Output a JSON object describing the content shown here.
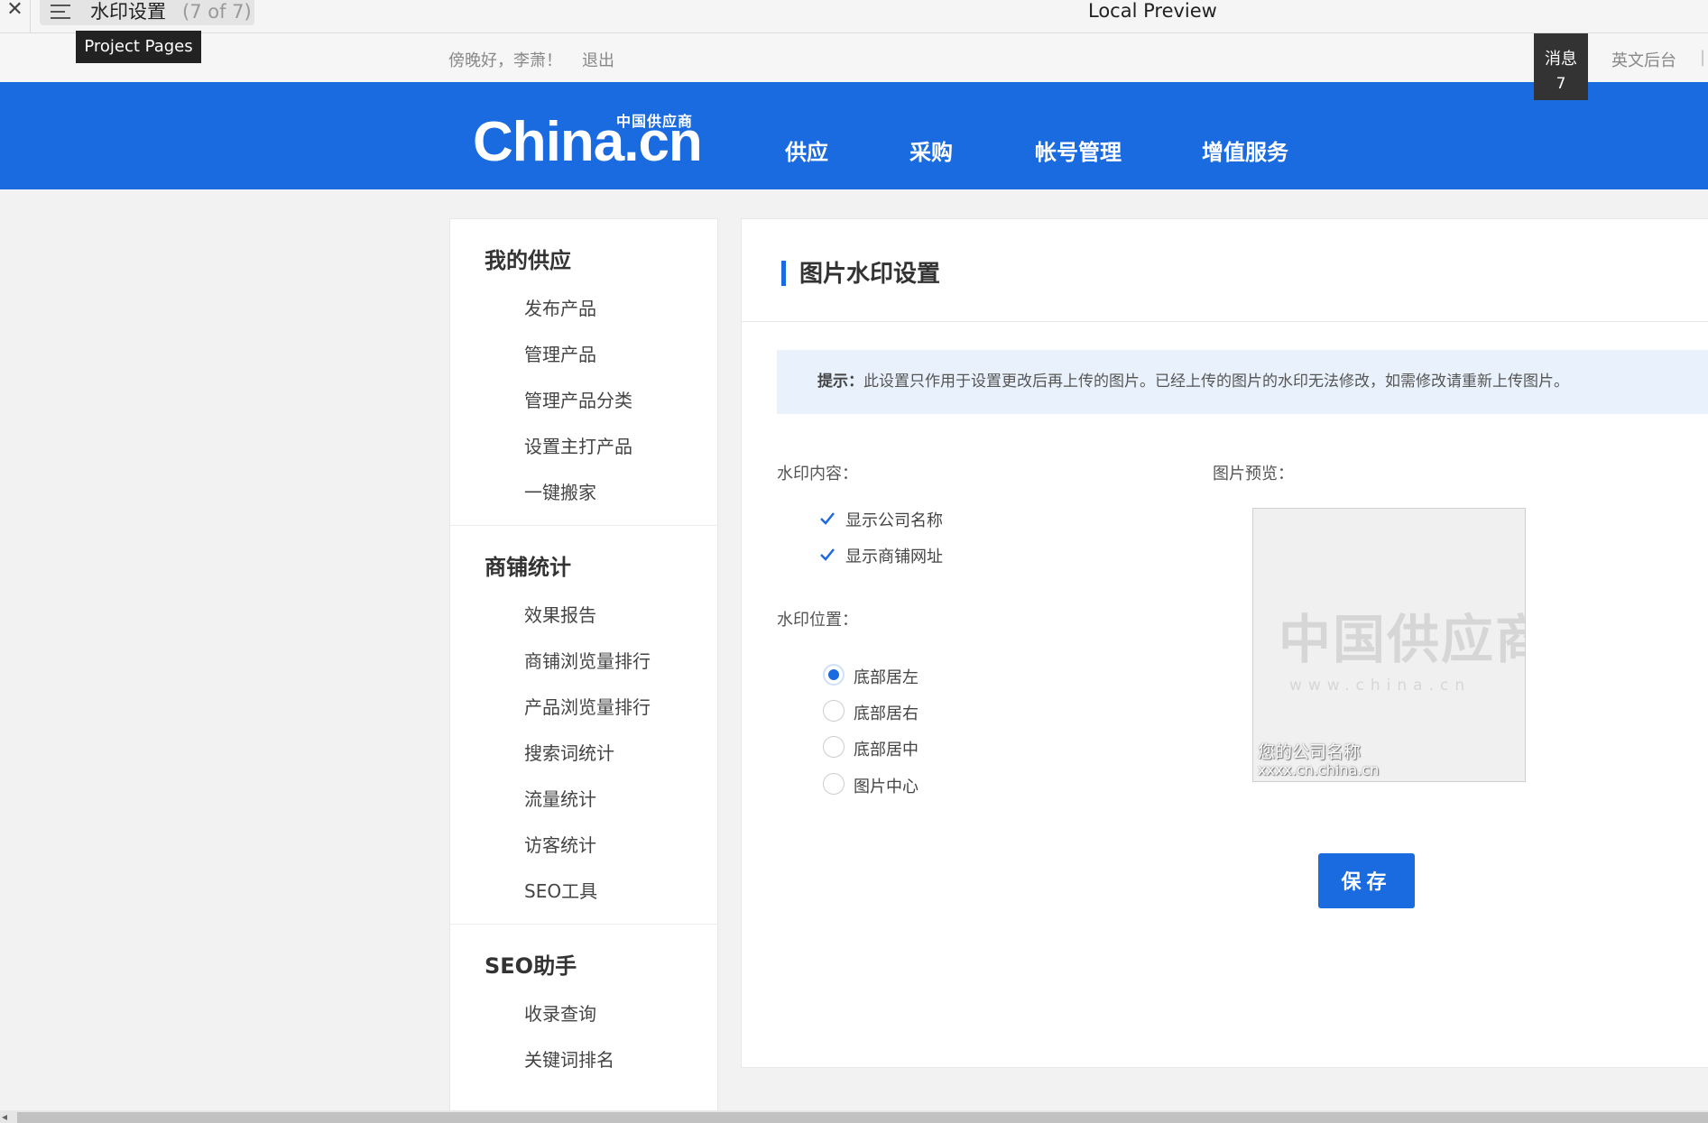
{
  "preview_bar": {
    "close_glyph": "✕",
    "doc_title": "水印设置",
    "doc_count": "(7 of 7)",
    "window_title": "Local Preview",
    "tooltip": "Project Pages"
  },
  "topbar": {
    "greeting": "傍晚好，李萧！",
    "logout": "退出",
    "message_label": "消息",
    "message_count": "7",
    "english_admin": "英文后台"
  },
  "header": {
    "logo_small": "中国供应商",
    "logo_main": "China.cn",
    "nav": [
      "供应",
      "采购",
      "帐号管理",
      "增值服务"
    ]
  },
  "sidebar": {
    "groups": [
      {
        "title": "我的供应",
        "items": [
          "发布产品",
          "管理产品",
          "管理产品分类",
          "设置主打产品",
          "一键搬家"
        ]
      },
      {
        "title": "商铺统计",
        "items": [
          "效果报告",
          "商铺浏览量排行",
          "产品浏览量排行",
          "搜索词统计",
          "流量统计",
          "访客统计",
          "SEO工具"
        ]
      },
      {
        "title": "SEO助手",
        "items": [
          "收录查询",
          "关键词排名"
        ]
      }
    ]
  },
  "main": {
    "title": "图片水印设置",
    "notice_prefix": "提示：",
    "notice_text": "此设置只作用于设置更改后再上传的图片。已经上传的图片的水印无法修改，如需修改请重新上传图片。",
    "content_label": "水印内容：",
    "content_options": [
      {
        "label": "显示公司名称",
        "checked": true
      },
      {
        "label": "显示商铺网址",
        "checked": true
      }
    ],
    "position_label": "水印位置：",
    "position_options": [
      {
        "label": "底部居左",
        "selected": true
      },
      {
        "label": "底部居右",
        "selected": false
      },
      {
        "label": "底部居中",
        "selected": false
      },
      {
        "label": "图片中心",
        "selected": false
      }
    ],
    "preview_label": "图片预览：",
    "preview": {
      "watermark_cn": "中国供应商",
      "watermark_url": "www.china.cn",
      "company_name": "您的公司名称",
      "site_url": "xxxx.cn.china.cn"
    },
    "save_label": "保存"
  },
  "colors": {
    "brand_blue": "#1a6ae0",
    "notice_bg": "#e9f2fc"
  }
}
